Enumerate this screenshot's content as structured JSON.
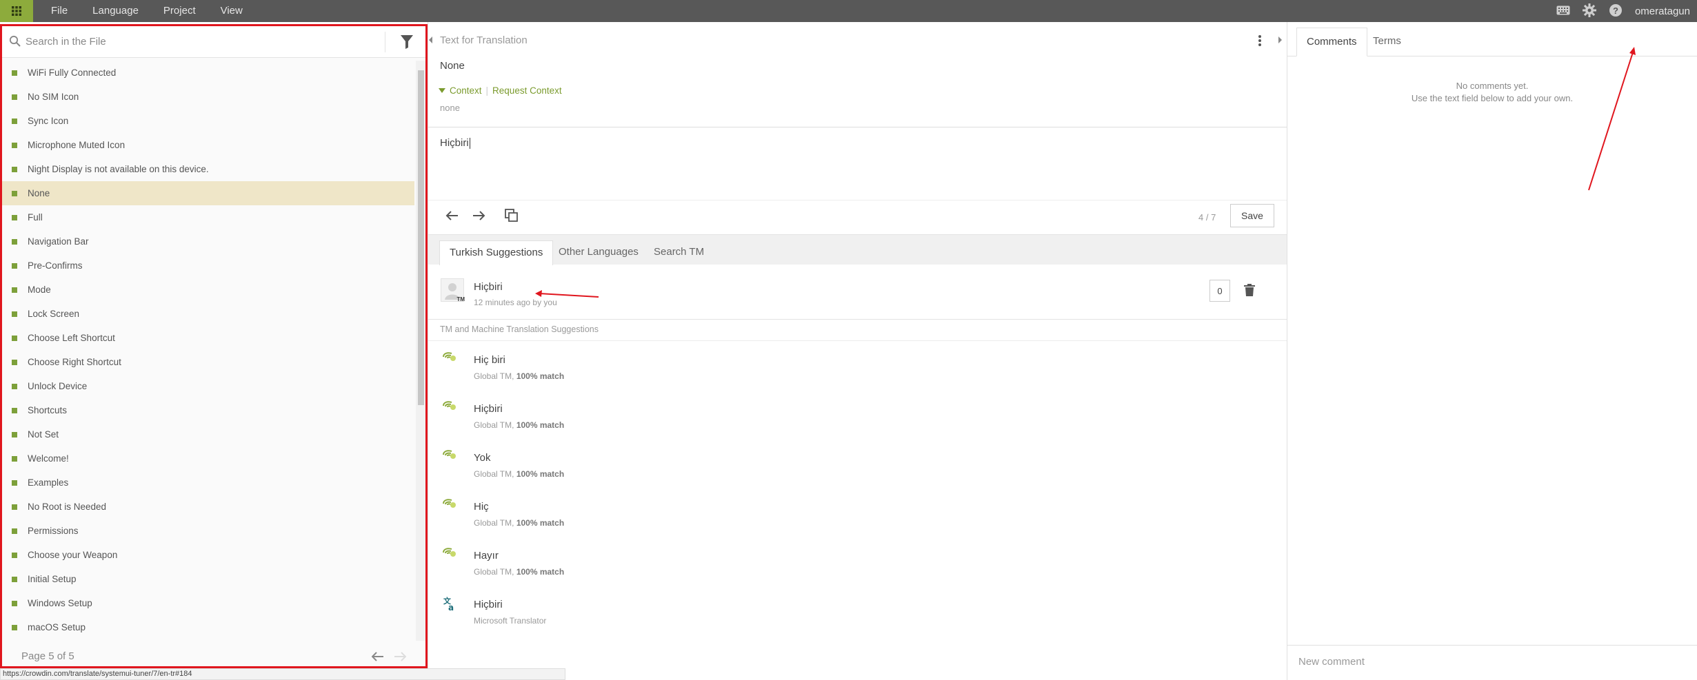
{
  "topbar": {
    "menu": [
      "File",
      "Language",
      "Project",
      "View"
    ],
    "username": "omeratagun",
    "icons": [
      "apps-grid-icon",
      "keyboard-icon",
      "gear-icon",
      "help-icon"
    ]
  },
  "left": {
    "search_placeholder": "Search in the File",
    "strings": [
      "WiFi Fully Connected",
      "No SIM Icon",
      "Sync Icon",
      "Microphone Muted Icon",
      "Night Display is not available on this device.",
      "None",
      "Full",
      "Navigation Bar",
      "Pre-Confirms",
      "Mode",
      "Lock Screen",
      "Choose Left Shortcut",
      "Choose Right Shortcut",
      "Unlock Device",
      "Shortcuts",
      "Not Set",
      "Welcome!",
      "Examples",
      "No Root is Needed",
      "Permissions",
      "Choose your Weapon",
      "Initial Setup",
      "Windows Setup",
      "macOS Setup"
    ],
    "selected_index": 5,
    "page_info": "Page 5 of 5"
  },
  "center": {
    "label": "Text for Translation",
    "source_text": "None",
    "context_label": "Context",
    "request_context": "Request Context",
    "context_value": "none",
    "translation": "Hiçbiri",
    "counter": "4 / 7",
    "save_label": "Save",
    "tabs": [
      "Turkish Suggestions",
      "Other Languages",
      "Search TM"
    ],
    "my_suggestion": {
      "text": "Hiçbiri",
      "meta": "12 minutes ago by you",
      "votes": "0",
      "badge": "TM"
    },
    "tm_heading": "TM and Machine Translation Suggestions",
    "suggestions": [
      {
        "text": "Hiç biri",
        "source": "Global TM, ",
        "match": "100% match",
        "icon": "global-tm-icon"
      },
      {
        "text": "Hiçbiri",
        "source": "Global TM, ",
        "match": "100% match",
        "icon": "global-tm-icon"
      },
      {
        "text": "Yok",
        "source": "Global TM, ",
        "match": "100% match",
        "icon": "global-tm-icon"
      },
      {
        "text": "Hiç",
        "source": "Global TM, ",
        "match": "100% match",
        "icon": "global-tm-icon"
      },
      {
        "text": "Hayır",
        "source": "Global TM, ",
        "match": "100% match",
        "icon": "global-tm-icon"
      },
      {
        "text": "Hiçbiri",
        "source": "Microsoft Translator",
        "match": "",
        "icon": "microsoft-translator-icon"
      }
    ]
  },
  "right": {
    "tabs": [
      "Comments",
      "Terms"
    ],
    "empty_line1": "No comments yet.",
    "empty_line2": "Use the text field below to add your own.",
    "new_comment_placeholder": "New comment"
  },
  "status_url": "https://crowdin.com/translate/systemui-tuner/7/en-tr#184",
  "colors": {
    "topbar": "#585858",
    "brand_green": "#8dab3c",
    "selected_row": "#efe6c8",
    "annotation_red": "#e0161e"
  }
}
